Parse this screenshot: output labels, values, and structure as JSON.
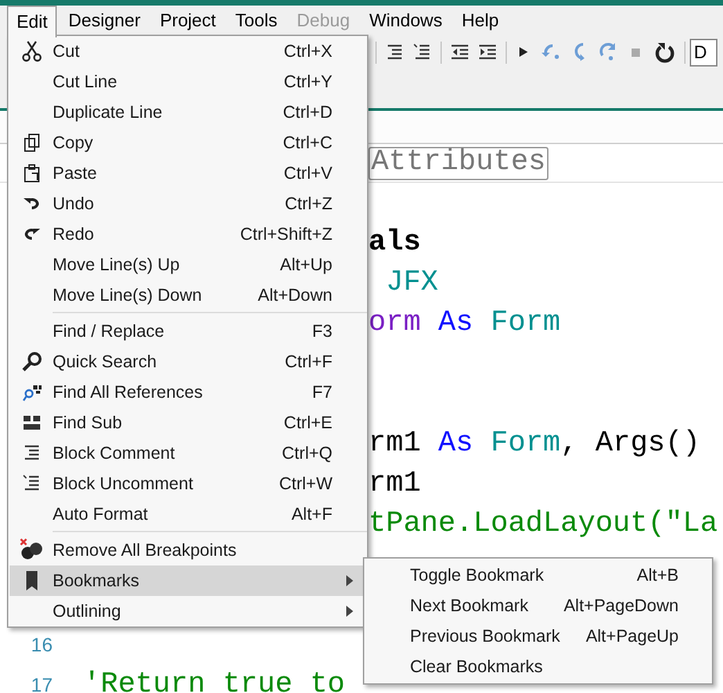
{
  "menubar": [
    {
      "label": "Edit",
      "selected": true,
      "disabled": false
    },
    {
      "label": "Designer",
      "selected": false,
      "disabled": false
    },
    {
      "label": "Project",
      "selected": false,
      "disabled": false
    },
    {
      "label": "Tools",
      "selected": false,
      "disabled": false
    },
    {
      "label": "Debug",
      "selected": false,
      "disabled": true
    },
    {
      "label": "Windows",
      "selected": false,
      "disabled": false
    },
    {
      "label": "Help",
      "selected": false,
      "disabled": false
    }
  ],
  "toolbar": {
    "combo_value": "D"
  },
  "tab": {
    "label": "Attributes"
  },
  "code": [
    {
      "tokens": [
        {
          "text": "als",
          "kind": "bold"
        }
      ]
    },
    {
      "tokens": [
        {
          "text": " JFX",
          "kind": "type"
        }
      ]
    },
    {
      "tokens": [
        {
          "text": "orm",
          "kind": "ident"
        },
        {
          "text": " As ",
          "kind": "keyword"
        },
        {
          "text": "Form",
          "kind": "type"
        }
      ]
    },
    {
      "tokens": [
        {
          "text": "rm1 ",
          "kind": "plain"
        },
        {
          "text": "As ",
          "kind": "keyword"
        },
        {
          "text": "Form",
          "kind": "type"
        },
        {
          "text": ", Args()",
          "kind": "plain"
        }
      ]
    },
    {
      "tokens": [
        {
          "text": "rm1",
          "kind": "plain"
        }
      ]
    },
    {
      "tokens": [
        {
          "text": "tPane.LoadLayout(\"La",
          "kind": "string"
        }
      ]
    },
    {
      "number": "16"
    },
    {
      "number": "17",
      "tokens": [
        {
          "text": "'Return true to",
          "kind": "comment"
        }
      ]
    }
  ],
  "edit_menu": [
    {
      "kind": "item",
      "label": "Cut",
      "shortcut": "Ctrl+X",
      "selected": false
    },
    {
      "kind": "item",
      "label": "Cut Line",
      "shortcut": "Ctrl+Y",
      "selected": false
    },
    {
      "kind": "item",
      "label": "Duplicate Line",
      "shortcut": "Ctrl+D",
      "selected": false
    },
    {
      "kind": "item",
      "label": "Copy",
      "shortcut": "Ctrl+C",
      "selected": false
    },
    {
      "kind": "item",
      "label": "Paste",
      "shortcut": "Ctrl+V",
      "selected": false
    },
    {
      "kind": "item",
      "label": "Undo",
      "shortcut": "Ctrl+Z",
      "selected": false
    },
    {
      "kind": "item",
      "label": "Redo",
      "shortcut": "Ctrl+Shift+Z",
      "selected": false
    },
    {
      "kind": "item",
      "label": "Move Line(s) Up",
      "shortcut": "Alt+Up",
      "selected": false
    },
    {
      "kind": "item",
      "label": "Move Line(s) Down",
      "shortcut": "Alt+Down",
      "selected": false
    },
    {
      "kind": "separator"
    },
    {
      "kind": "item",
      "label": "Find / Replace",
      "shortcut": "F3",
      "selected": false
    },
    {
      "kind": "item",
      "label": "Quick Search",
      "shortcut": "Ctrl+F",
      "selected": false
    },
    {
      "kind": "item",
      "label": "Find All References",
      "shortcut": "F7",
      "selected": false
    },
    {
      "kind": "item",
      "label": "Find Sub",
      "shortcut": "Ctrl+E",
      "selected": false
    },
    {
      "kind": "item",
      "label": "Block Comment",
      "shortcut": "Ctrl+Q",
      "selected": false
    },
    {
      "kind": "item",
      "label": "Block Uncomment",
      "shortcut": "Ctrl+W",
      "selected": false
    },
    {
      "kind": "item",
      "label": "Auto Format",
      "shortcut": "Alt+F",
      "selected": false
    },
    {
      "kind": "separator"
    },
    {
      "kind": "item",
      "label": "Remove All Breakpoints",
      "selected": false
    },
    {
      "kind": "submenu",
      "label": "Bookmarks",
      "selected": true
    },
    {
      "kind": "submenu",
      "label": "Outlining",
      "selected": false
    }
  ],
  "bookmarks_submenu": [
    {
      "label": "Toggle Bookmark",
      "shortcut": "Alt+B"
    },
    {
      "label": "Next Bookmark",
      "shortcut": "Alt+PageDown"
    },
    {
      "label": "Previous Bookmark",
      "shortcut": "Alt+PageUp"
    },
    {
      "label": "Clear Bookmarks"
    }
  ]
}
